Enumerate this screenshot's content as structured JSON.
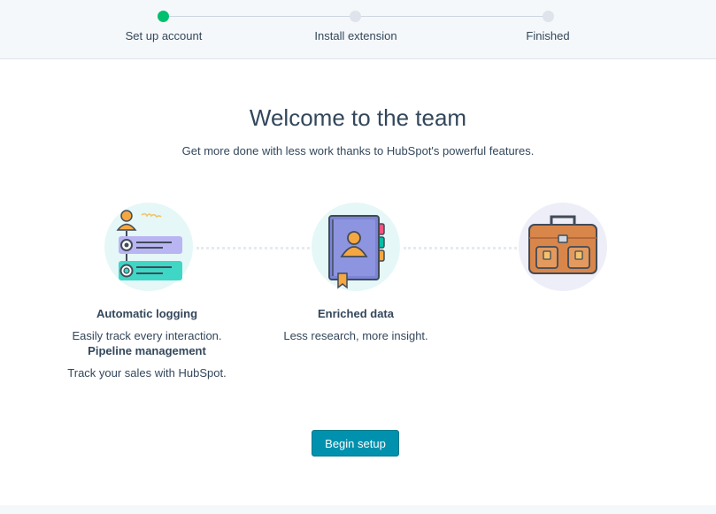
{
  "stepper": {
    "steps": [
      {
        "label": "Set up account",
        "status": "complete"
      },
      {
        "label": "Install extension",
        "status": "pending"
      },
      {
        "label": "Finished",
        "status": "pending"
      }
    ],
    "active_color": "#00bf6f",
    "inactive_color": "#dfe3eb"
  },
  "main": {
    "title": "Welcome to the team",
    "subtitle": "Get more done with less work thanks to HubSpot's powerful features."
  },
  "features": [
    {
      "icon": "timeline-icon",
      "title": "Automatic logging",
      "description": "Easily track every interaction."
    },
    {
      "icon": "contact-book-icon",
      "title": "Enriched data",
      "description": "Less research, more insight."
    },
    {
      "icon": "briefcase-icon",
      "title": "Pipeline management",
      "description": "Track your sales with HubSpot."
    }
  ],
  "actions": {
    "begin_label": "Begin setup",
    "button_color": "#0091ae"
  }
}
